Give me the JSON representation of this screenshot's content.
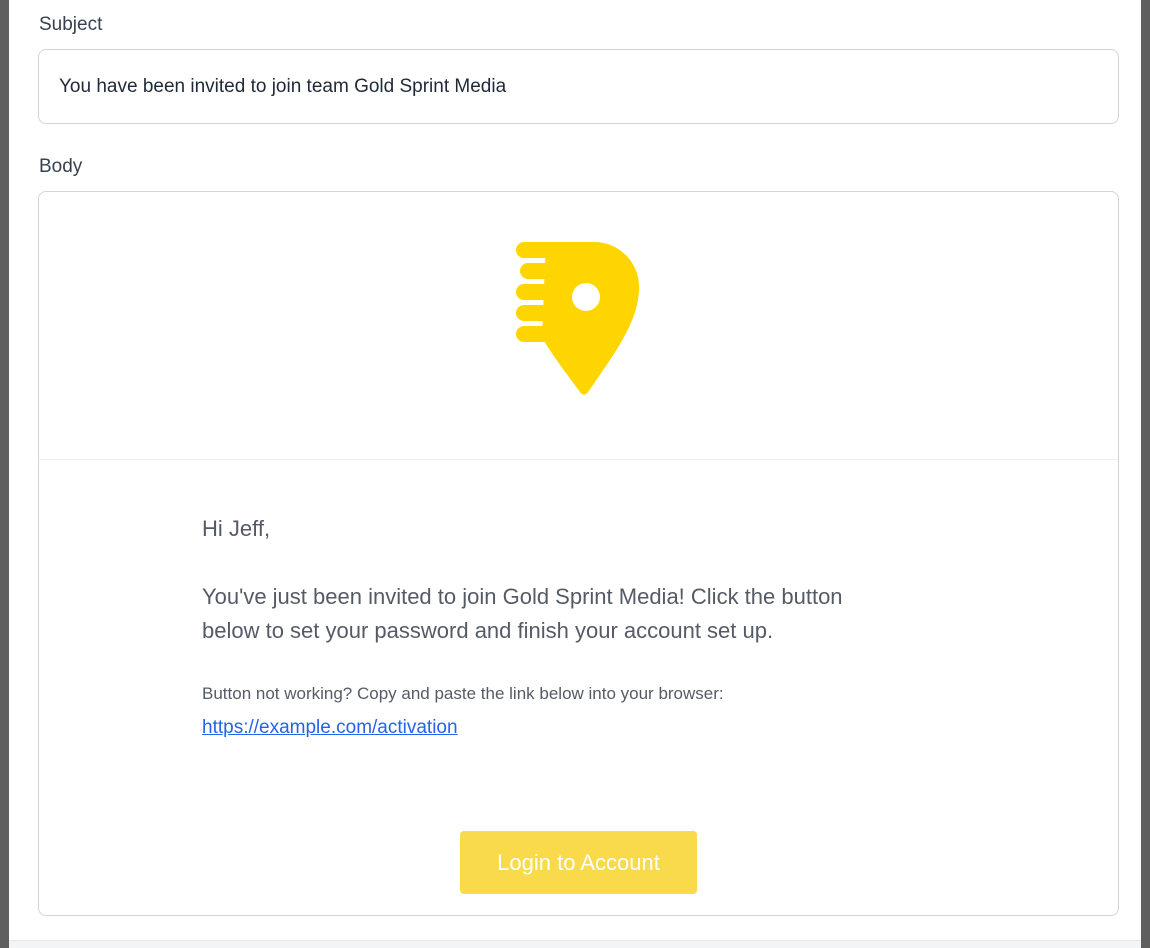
{
  "form": {
    "subject_label": "Subject",
    "subject_value": "You have been invited to join team Gold Sprint Media",
    "body_label": "Body"
  },
  "email": {
    "logo_icon": "location-pin-speed-icon",
    "logo_color": "#FFD500",
    "greeting": "Hi Jeff,",
    "intro_line1": "You've just been invited to join Gold Sprint Media! Click the button",
    "intro_line2": "below to set your password and finish your account set up.",
    "fallback_text": "Button not working? Copy and paste the link below into your browser:",
    "fallback_link": "https://example.com/activation",
    "button_label": "Login to Account",
    "button_color": "#F9DA4B",
    "link_color": "#2563EB"
  }
}
